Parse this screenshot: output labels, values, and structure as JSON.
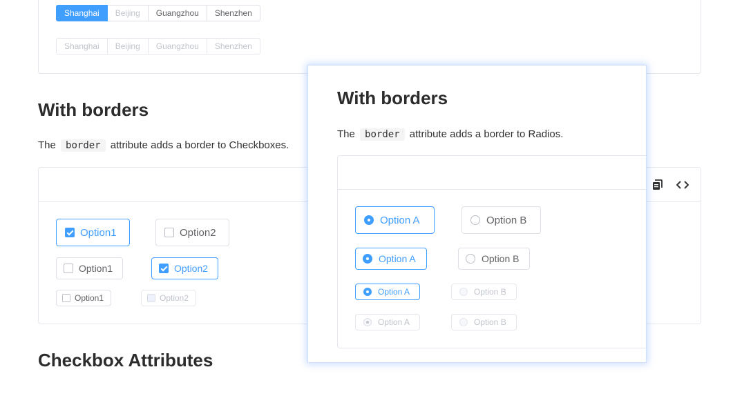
{
  "button_group_1": [
    "Shanghai",
    "Beijing",
    "Guangzhou",
    "Shenzhen"
  ],
  "button_group_2": [
    "Shanghai",
    "Beijing",
    "Guangzhou",
    "Shenzhen"
  ],
  "borders_section": {
    "title": "With borders",
    "desc_pre": "The",
    "desc_code": "border",
    "desc_post": "attribute adds a border to Checkboxes.",
    "checkboxes": [
      {
        "label": "Option1",
        "checked": true
      },
      {
        "label": "Option2",
        "checked": false
      },
      {
        "label": "Option1",
        "checked": false
      },
      {
        "label": "Option2",
        "checked": true
      },
      {
        "label": "Option1",
        "checked": false
      },
      {
        "label": "Option2",
        "checked": false,
        "disabled": true
      }
    ]
  },
  "next_section": {
    "title": "Checkbox Attributes"
  },
  "popover": {
    "title": "With borders",
    "desc_pre": "The",
    "desc_code": "border",
    "desc_post": "attribute adds a border to Radios.",
    "radios": [
      {
        "label": "Option A",
        "checked": true
      },
      {
        "label": "Option B",
        "checked": false
      },
      {
        "label": "Option A",
        "checked": true
      },
      {
        "label": "Option B",
        "checked": false
      },
      {
        "label": "Option A",
        "checked": true
      },
      {
        "label": "Option B",
        "checked": false,
        "disabled": true
      },
      {
        "label": "Option A",
        "checked": true,
        "disabled": true
      },
      {
        "label": "Option B",
        "checked": false,
        "disabled": true
      }
    ]
  },
  "icons": {
    "copy": "copy-icon",
    "code": "code-icon"
  },
  "colors": {
    "primary": "#409eff",
    "border": "#dcdfe6",
    "disabled_text": "#c0c4cc"
  }
}
